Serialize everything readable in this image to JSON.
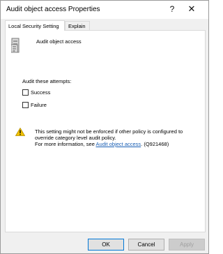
{
  "window": {
    "title": "Audit object access Properties"
  },
  "titlebar": {
    "help_glyph": "?",
    "close_glyph": "✕"
  },
  "tabs": [
    {
      "label": "Local Security Setting",
      "active": true
    },
    {
      "label": "Explain",
      "active": false
    }
  ],
  "policy": {
    "name": "Audit object access",
    "icon": "server-policy-icon"
  },
  "audit": {
    "heading": "Audit these attempts:",
    "success_label": "Success",
    "success_checked": false,
    "failure_label": "Failure",
    "failure_checked": false
  },
  "warning": {
    "icon": "warning-triangle-icon",
    "line1": "This setting might not be enforced if other policy is configured to",
    "line2": "override category level audit policy.",
    "line3_prefix": "For more information, see ",
    "link_text": "Audit object access",
    "line3_suffix": ". (Q921468)"
  },
  "buttons": {
    "ok": "OK",
    "cancel": "Cancel",
    "apply": "Apply"
  },
  "colors": {
    "accent": "#0078d7",
    "link": "#1a5fb4",
    "warning": "#f2c200"
  }
}
